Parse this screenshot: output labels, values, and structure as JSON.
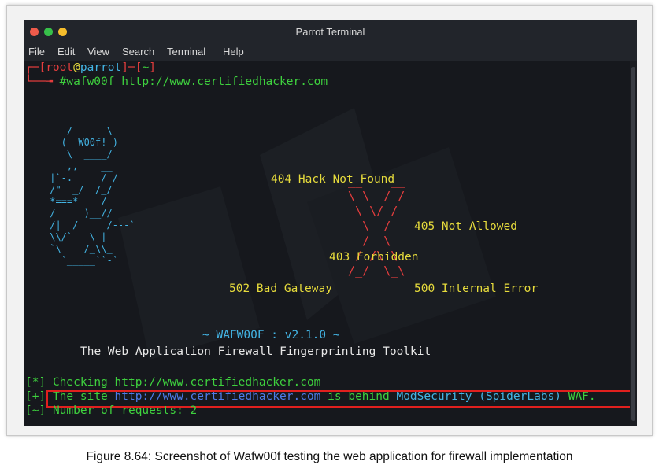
{
  "window": {
    "title": "Parrot Terminal"
  },
  "menu": [
    "File",
    "Edit",
    "View",
    "Search",
    "Terminal",
    "Help"
  ],
  "prompt": {
    "open": "┌─[",
    "user": "root",
    "at": "@",
    "host": "parrot",
    "mid": "]─[",
    "dir": "~",
    "close": "]",
    "arrow": "└──╼ ",
    "command": "#wafw00f http://www.certifiedhacker.com"
  },
  "ascii": {
    "dog": "     ______\n    /      \\\n   (  W00f! )\n    \\  ____/\n    ,,    __\n |`-.__   / /\n /\"  _/  /_/\n *===*    /\n /     )__//\n /|  /     /---`\n \\\\/`   \\ |\n `\\    /_\\\\_\n   `_____``-`",
    "x": "  __    __\n  \\ \\  / /\n   \\ \\/ /\n    \\  /\n    /  \\\n   / /\\ \\\n  /_/  \\_\\"
  },
  "labels": {
    "not_found": "404 Hack Not Found",
    "not_allowed": "405 Not Allowed",
    "forbidden": "403 Forbidden",
    "bad_gateway": "502 Bad Gateway",
    "internal_error": "500 Internal Error"
  },
  "banner": {
    "version": "~ WAFW00F : v2.1.0 ~",
    "tagline": "The Web Application Firewall Fingerprinting Toolkit"
  },
  "output": {
    "checking_tag": "[*]",
    "checking_text": "Checking http://www.certifiedhacker.com",
    "result_tag": "[+]",
    "result_prefix": "The site",
    "result_url": "http://www.certifiedhacker.com",
    "result_mid": "is behind",
    "result_waf": "ModSecurity (SpiderLabs)",
    "result_suffix": "WAF.",
    "requests_tag": "[~]",
    "requests_text": "Number of requests: 2"
  },
  "caption": "Figure 8.64: Screenshot of Wafw00f testing the web application for firewall implementation",
  "colors": {
    "red": "#e33d3d",
    "green": "#3ed13e",
    "yellow": "#e6db3c",
    "cyan": "#43b4e4",
    "blue": "#4d7be8",
    "highlight": "#e0201e"
  }
}
